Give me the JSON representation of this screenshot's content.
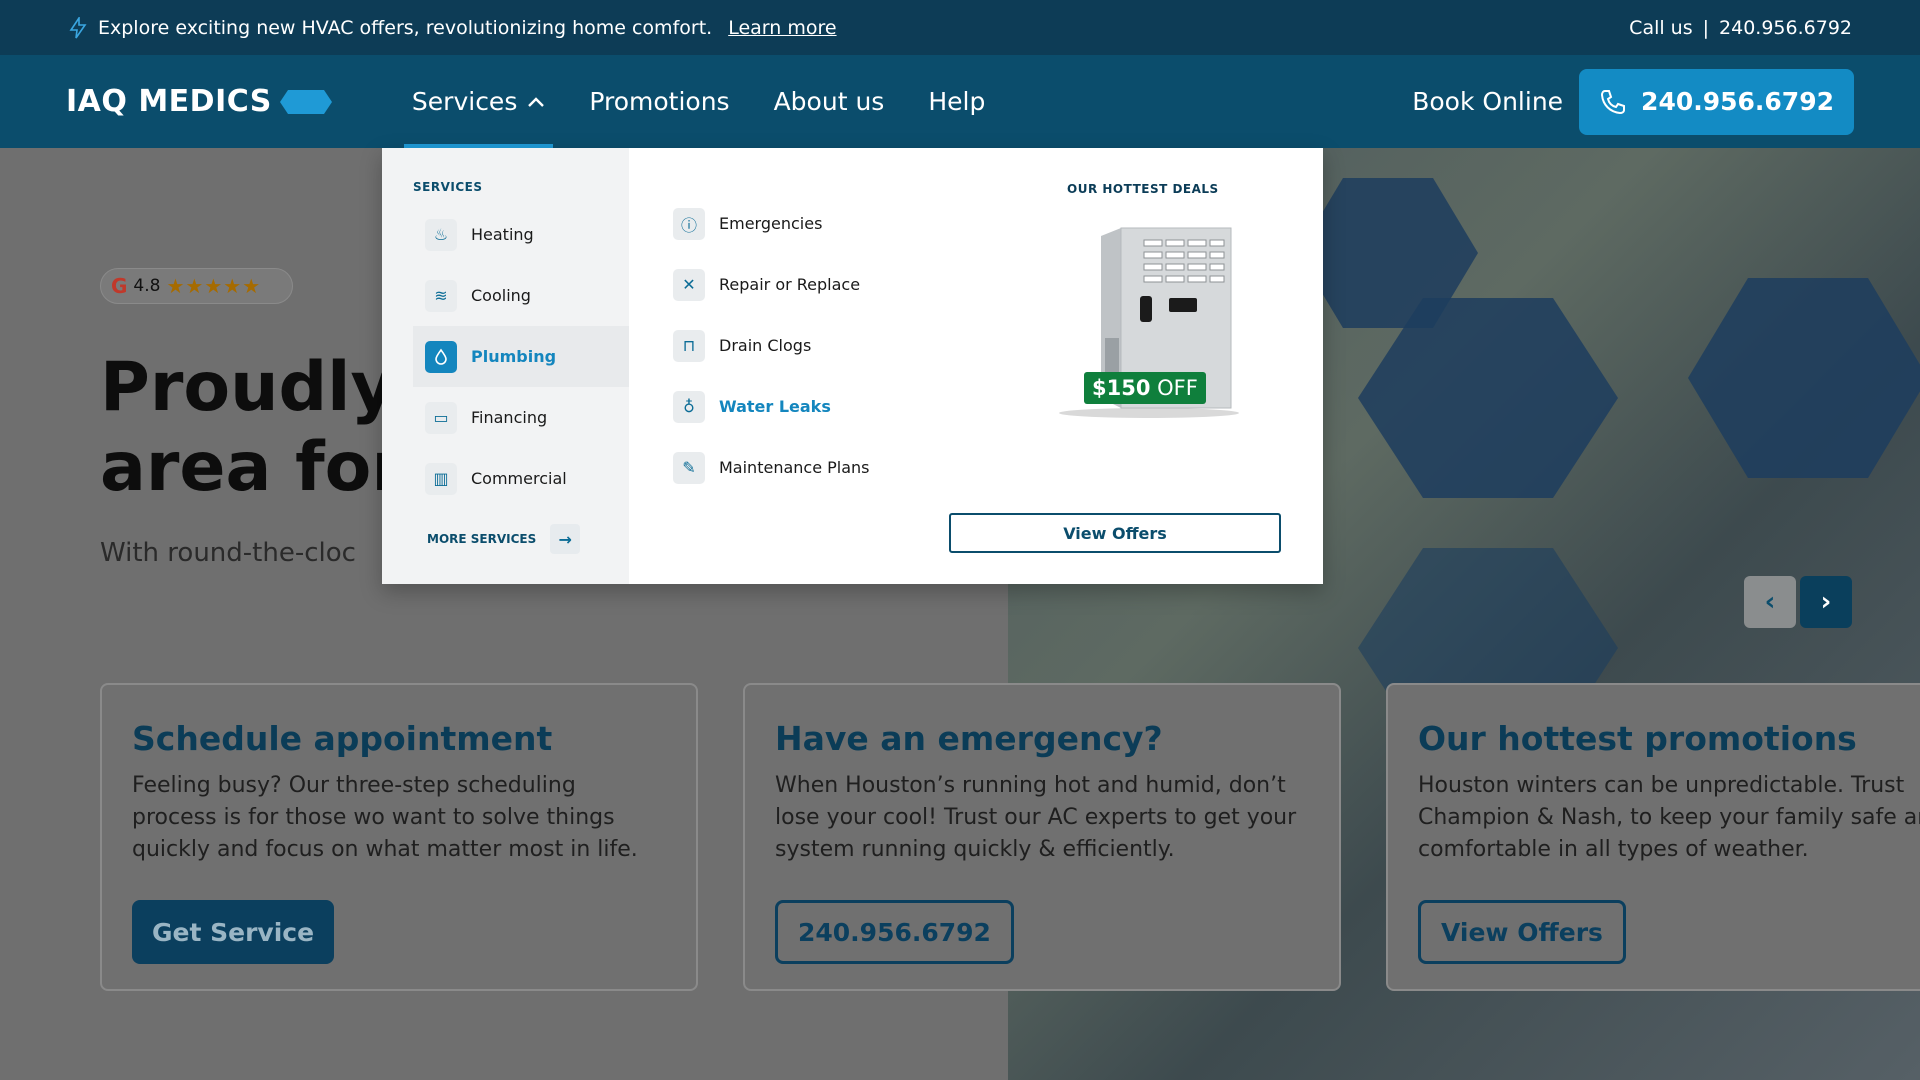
{
  "topbar": {
    "message": "Explore exciting new HVAC offers, revolutionizing home comfort.",
    "learn_more": "Learn more",
    "call_label": "Call us",
    "separator": "|",
    "phone": "240.956.6792"
  },
  "navbar": {
    "logo": "IAQ MEDICS",
    "items": [
      {
        "label": "Services"
      },
      {
        "label": "Promotions"
      },
      {
        "label": "About us"
      },
      {
        "label": "Help"
      }
    ],
    "book_online": "Book Online",
    "phone": "240.956.6792"
  },
  "hero": {
    "rating_value": "4.8",
    "stars": "★★★★★",
    "headline_line1": "Proudly s",
    "headline_line2": "area for",
    "subline": "With round-the-cloc"
  },
  "dropdown": {
    "services_label": "SERVICES",
    "services": [
      {
        "label": "Heating",
        "icon": "flame-icon",
        "glyph": "♨"
      },
      {
        "label": "Cooling",
        "icon": "wind-icon",
        "glyph": "≋"
      },
      {
        "label": "Plumbing",
        "icon": "water-drop-icon",
        "glyph": "💧"
      },
      {
        "label": "Financing",
        "icon": "wallet-icon",
        "glyph": "▭"
      },
      {
        "label": "Commercial",
        "icon": "building-icon",
        "glyph": "▥"
      }
    ],
    "more_services": "MORE SERVICES",
    "sub_services": [
      {
        "label": "Emergencies",
        "icon": "alert-icon",
        "glyph": "ⓘ"
      },
      {
        "label": "Repair or Replace",
        "icon": "tools-icon",
        "glyph": "✕"
      },
      {
        "label": "Drain Clogs",
        "icon": "drain-icon",
        "glyph": "⊓"
      },
      {
        "label": "Water Leaks",
        "icon": "leak-icon",
        "glyph": "♁"
      },
      {
        "label": "Maintenance Plans",
        "icon": "wrench-icon",
        "glyph": "✎"
      }
    ],
    "deals_label": "OUR HOTTEST DEALS",
    "badge_amount": "$150",
    "badge_suffix": "OFF",
    "view_offers": "View Offers"
  },
  "cards": [
    {
      "title": "Schedule appointment",
      "text": "Feeling busy? Our three-step scheduling process is for those wo want to solve things quickly and focus on what matter most in life.",
      "button": "Get Service"
    },
    {
      "title": "Have an emergency?",
      "text": "When Houston’s running hot and humid, don’t lose your cool! Trust our AC experts to get your system running quickly & efficiently.",
      "button": "240.956.6792"
    },
    {
      "title": "Our hottest promotions",
      "text": "Houston winters can be unpredictable. Trust Champion & Nash, to keep your family safe and comfortable in all types of weather.",
      "button": "View Offers"
    }
  ],
  "colors": {
    "topbar": "#0d3c56",
    "navbar": "#0b4d6c",
    "accent": "#138bc4",
    "badge": "#0f7f3c"
  }
}
